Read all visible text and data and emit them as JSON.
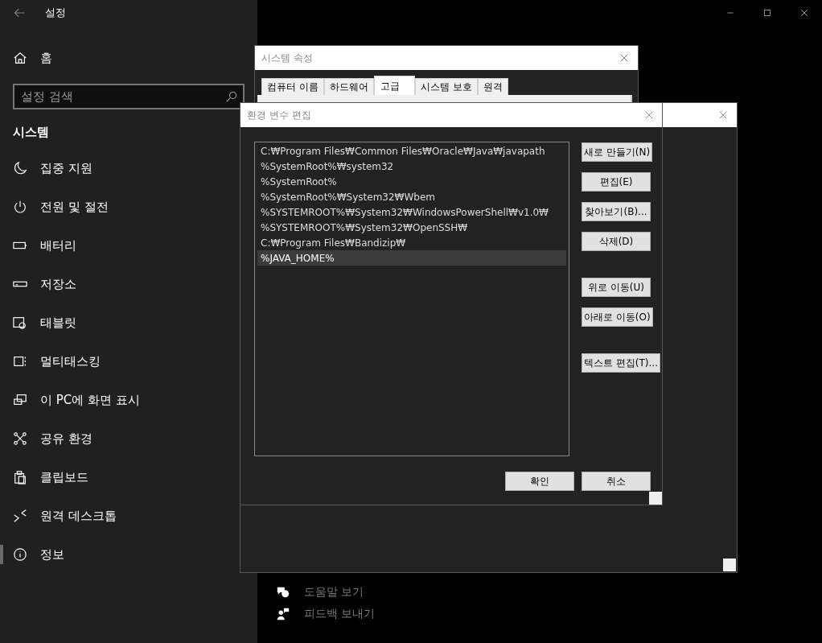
{
  "settings": {
    "title": "설정",
    "home": "홈",
    "search": {
      "placeholder": "설정 검색"
    },
    "section": "시스템",
    "items": [
      {
        "label": "집중 지원",
        "selected": false
      },
      {
        "label": "전원 및 절전",
        "selected": false
      },
      {
        "label": "배터리",
        "selected": false
      },
      {
        "label": "저장소",
        "selected": false
      },
      {
        "label": "태블릿",
        "selected": false
      },
      {
        "label": "멀티태스킹",
        "selected": false
      },
      {
        "label": "이 PC에 화면 표시",
        "selected": false
      },
      {
        "label": "공유 환경",
        "selected": false
      },
      {
        "label": "클립보드",
        "selected": false
      },
      {
        "label": "원격 데스크톱",
        "selected": false
      },
      {
        "label": "정보",
        "selected": true
      }
    ],
    "links": [
      "도움말 보기",
      "피드백 보내기"
    ]
  },
  "system_properties": {
    "title": "시스템 속성",
    "tabs": [
      {
        "label": "컴퓨터 이름",
        "selected": false
      },
      {
        "label": "하드웨어",
        "selected": false
      },
      {
        "label": "고급",
        "selected": true
      },
      {
        "label": "시스템 보호",
        "selected": false
      },
      {
        "label": "원격",
        "selected": false
      }
    ]
  },
  "env_editor": {
    "title": "환경 변수 편집",
    "entries": [
      {
        "text": "C:₩Program Files₩Common Files₩Oracle₩Java₩javapath",
        "selected": false
      },
      {
        "text": "%SystemRoot%₩system32",
        "selected": false
      },
      {
        "text": "%SystemRoot%",
        "selected": false
      },
      {
        "text": "%SystemRoot%₩System32₩Wbem",
        "selected": false
      },
      {
        "text": "%SYSTEMROOT%₩System32₩WindowsPowerShell₩v1.0₩",
        "selected": false
      },
      {
        "text": "%SYSTEMROOT%₩System32₩OpenSSH₩",
        "selected": false
      },
      {
        "text": "C:₩Program Files₩Bandizip₩",
        "selected": false
      },
      {
        "text": "%JAVA_HOME%",
        "selected": true
      }
    ],
    "button_groups": [
      [
        "새로 만들기(N)",
        "편집(E)",
        "찾아보기(B)...",
        "삭제(D)"
      ],
      [
        "위로 이동(U)",
        "아래로 이동(O)"
      ],
      [
        "텍스트 편집(T)..."
      ]
    ],
    "footer_buttons": [
      "확인",
      "취소"
    ]
  }
}
